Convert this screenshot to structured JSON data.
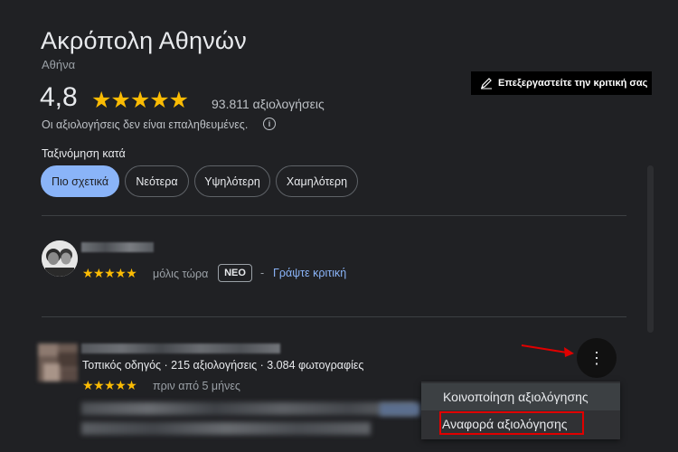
{
  "place": {
    "title": "Ακρόπολη Αθηνών",
    "location": "Αθήνα",
    "rating": "4,8",
    "stars": "★★★★★",
    "review_count": "93.811 αξιολογήσεις",
    "unverified_notice": "Οι αξιολογήσεις δεν είναι επαληθευμένες.",
    "info_icon": "i"
  },
  "edit_review": {
    "label": "Επεξεργαστείτε την κριτική σας",
    "icon": "pen-icon"
  },
  "sort": {
    "label": "Ταξινόμηση κατά",
    "options": [
      "Πιο σχετικά",
      "Νεότερα",
      "Υψηλότερη",
      "Χαμηλότερη"
    ],
    "selected": "Πιο σχετικά"
  },
  "reviews": [
    {
      "stars": "★★★★★",
      "time": "μόλις τώρα",
      "badge": "ΝΕΟ",
      "separator": "-",
      "write_link": "Γράψτε κριτική"
    },
    {
      "reviewer_meta": "Τοπικός οδηγός · 215 αξιολογήσεις · 3.084 φωτογραφίες",
      "stars": "★★★★★",
      "time": "πριν από 5 μήνες",
      "more_icon": "⋮"
    }
  ],
  "context_menu": {
    "items": [
      "Κοινοποίηση αξιολόγησης",
      "Αναφορά αξιολόγησης"
    ]
  },
  "colors": {
    "background": "#202124",
    "accent": "#8ab4f8",
    "star": "#fbbc04",
    "highlight_box": "#e00000"
  }
}
